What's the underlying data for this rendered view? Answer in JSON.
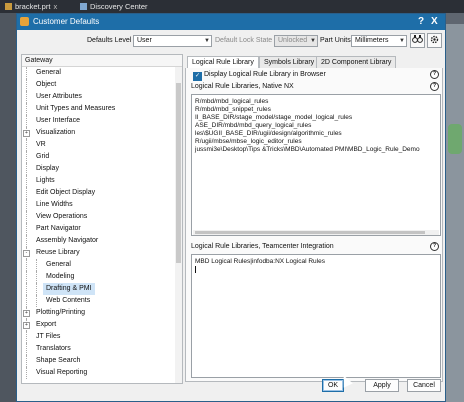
{
  "background_tabs": [
    {
      "label": "bracket.prt",
      "close": "x"
    },
    {
      "label": "Discovery Center"
    }
  ],
  "dialog": {
    "title": "Customer Defaults",
    "help": "?",
    "close": "X",
    "accent": "#1e6ea8"
  },
  "toolbar": {
    "defaults_level_label": "Defaults Level",
    "defaults_level_value": "User",
    "default_lock_state_label": "Default Lock State",
    "lock_state_value": "Unlocked",
    "part_units_label": "Part Units",
    "part_units_value": "Millimeters",
    "binoculars_icon": "binoculars-icon",
    "settings_icon": "gear-icon"
  },
  "tree": {
    "header": "Gateway",
    "items": [
      {
        "label": "General",
        "level": 1
      },
      {
        "label": "Object",
        "level": 1
      },
      {
        "label": "User Attributes",
        "level": 1
      },
      {
        "label": "Unit Types and Measures",
        "level": 1
      },
      {
        "label": "User Interface",
        "level": 1
      },
      {
        "label": "Visualization",
        "level": 1,
        "expander": "+"
      },
      {
        "label": "VR",
        "level": 1
      },
      {
        "label": "Grid",
        "level": 1
      },
      {
        "label": "Display",
        "level": 1
      },
      {
        "label": "Lights",
        "level": 1
      },
      {
        "label": "Edit Object Display",
        "level": 1
      },
      {
        "label": "Line Widths",
        "level": 1
      },
      {
        "label": "View Operations",
        "level": 1
      },
      {
        "label": "Part Navigator",
        "level": 1
      },
      {
        "label": "Assembly Navigator",
        "level": 1
      },
      {
        "label": "Reuse Library",
        "level": 1,
        "expander": "-"
      },
      {
        "label": "General",
        "level": 2
      },
      {
        "label": "Modeling",
        "level": 2
      },
      {
        "label": "Drafting & PMI",
        "level": 2,
        "selected": true
      },
      {
        "label": "Web Contents",
        "level": 2
      },
      {
        "label": "Plotting/Printing",
        "level": 1,
        "expander": "+"
      },
      {
        "label": "Export",
        "level": 1,
        "expander": "+"
      },
      {
        "label": "JT Files",
        "level": 1
      },
      {
        "label": "Translators",
        "level": 1
      },
      {
        "label": "Shape Search",
        "level": 1
      },
      {
        "label": "Visual Reporting",
        "level": 1
      }
    ]
  },
  "tabs": [
    {
      "label": "Logical Rule Library",
      "active": true
    },
    {
      "label": "Symbols Library"
    },
    {
      "label": "2D Component Library"
    }
  ],
  "panel": {
    "display_checkbox_label": "Display Logical Rule Library in Browser",
    "native_section_label": "Logical Rule Libraries, Native NX",
    "native_lines": [
      "R/mbd/mbd_logical_rules",
      "R/mbd/mbd_snippet_rules",
      "II_BASE_DIR/stage_model/stage_model_logical_rules",
      "ASE_DIR/mbd/mbd_query_logical_rules",
      "les\\$UGII_BASE_DIR/ugii/design/algorithmic_rules",
      "R/ugii/mbse/mbse_logic_editor_rules",
      "jussmi3e\\Desktop\\Tips &Tricks\\MBD\\Automated PMI\\MBD_Logic_Rule_Demo"
    ],
    "teamcenter_section_label": "Logical Rule Libraries, Teamcenter Integration",
    "teamcenter_lines": [
      "MBD Logical Rules|infodba:NX Logical Rules"
    ],
    "info_glyph": "?"
  },
  "buttons": {
    "ok": "OK",
    "apply": "Apply",
    "cancel": "Cancel"
  }
}
